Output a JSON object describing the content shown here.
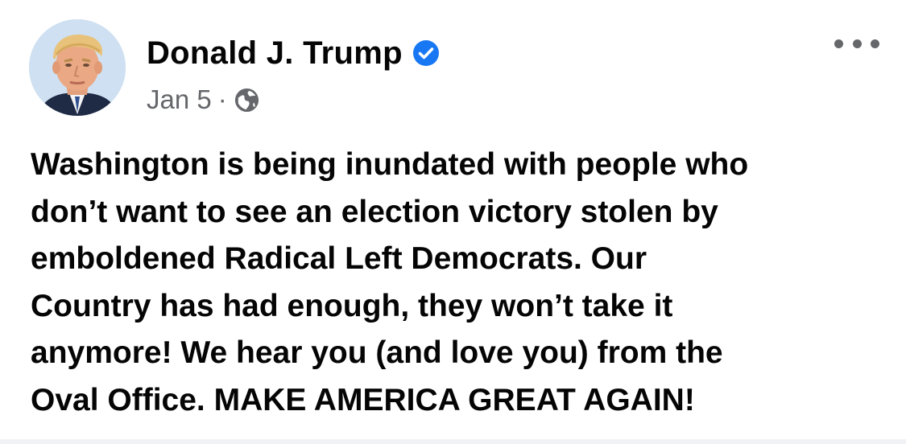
{
  "post": {
    "author": "Donald J. Trump",
    "verified": true,
    "date": "Jan 5",
    "separator": "·",
    "audience_icon": "globe-icon",
    "more_icon": "more-options-icon",
    "text_lines": [
      "Washington is being inundated with people who",
      "don’t want to see an election victory stolen by",
      "emboldened Radical Left Democrats. Our",
      "Country has had enough, they won’t take it",
      "anymore! We hear you (and love you) from the",
      "Oval Office. MAKE AMERICA GREAT AGAIN!"
    ]
  },
  "colors": {
    "text": "#050505",
    "meta": "#65676b",
    "verified_badge": "#1877f2",
    "divider": "#f0f2f5"
  }
}
